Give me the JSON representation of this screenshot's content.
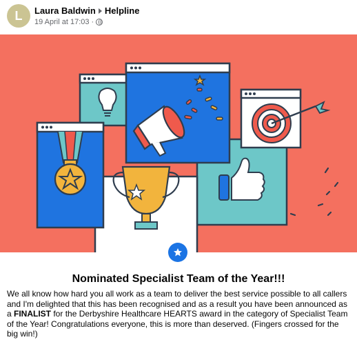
{
  "post": {
    "avatar_letter": "L",
    "author": "Laura Baldwin",
    "group": "Helpline",
    "timestamp": "19 April at 17:03",
    "separator": "·",
    "privacy_icon": "globe-icon"
  },
  "card": {
    "badge_icon": "star-badge-icon",
    "title": "Nominated Specialist Team of the Year!!!",
    "body_part1": "We all know how hard you all work as a team to deliver the best service possible to all callers and I'm delighted that this has been recognised and as a result you have been announced as a ",
    "body_bold": "FINALIST",
    "body_part2": " for the Derbyshire Healthcare HEARTS award in the category of Specialist Team of the Year! Congratulations everyone, this is more than deserved. (Fingers crossed for the big win!)"
  },
  "colors": {
    "illustration_bg": "#f4705f",
    "accent_blue": "#1b74e4",
    "avatar": "#cbc493"
  }
}
